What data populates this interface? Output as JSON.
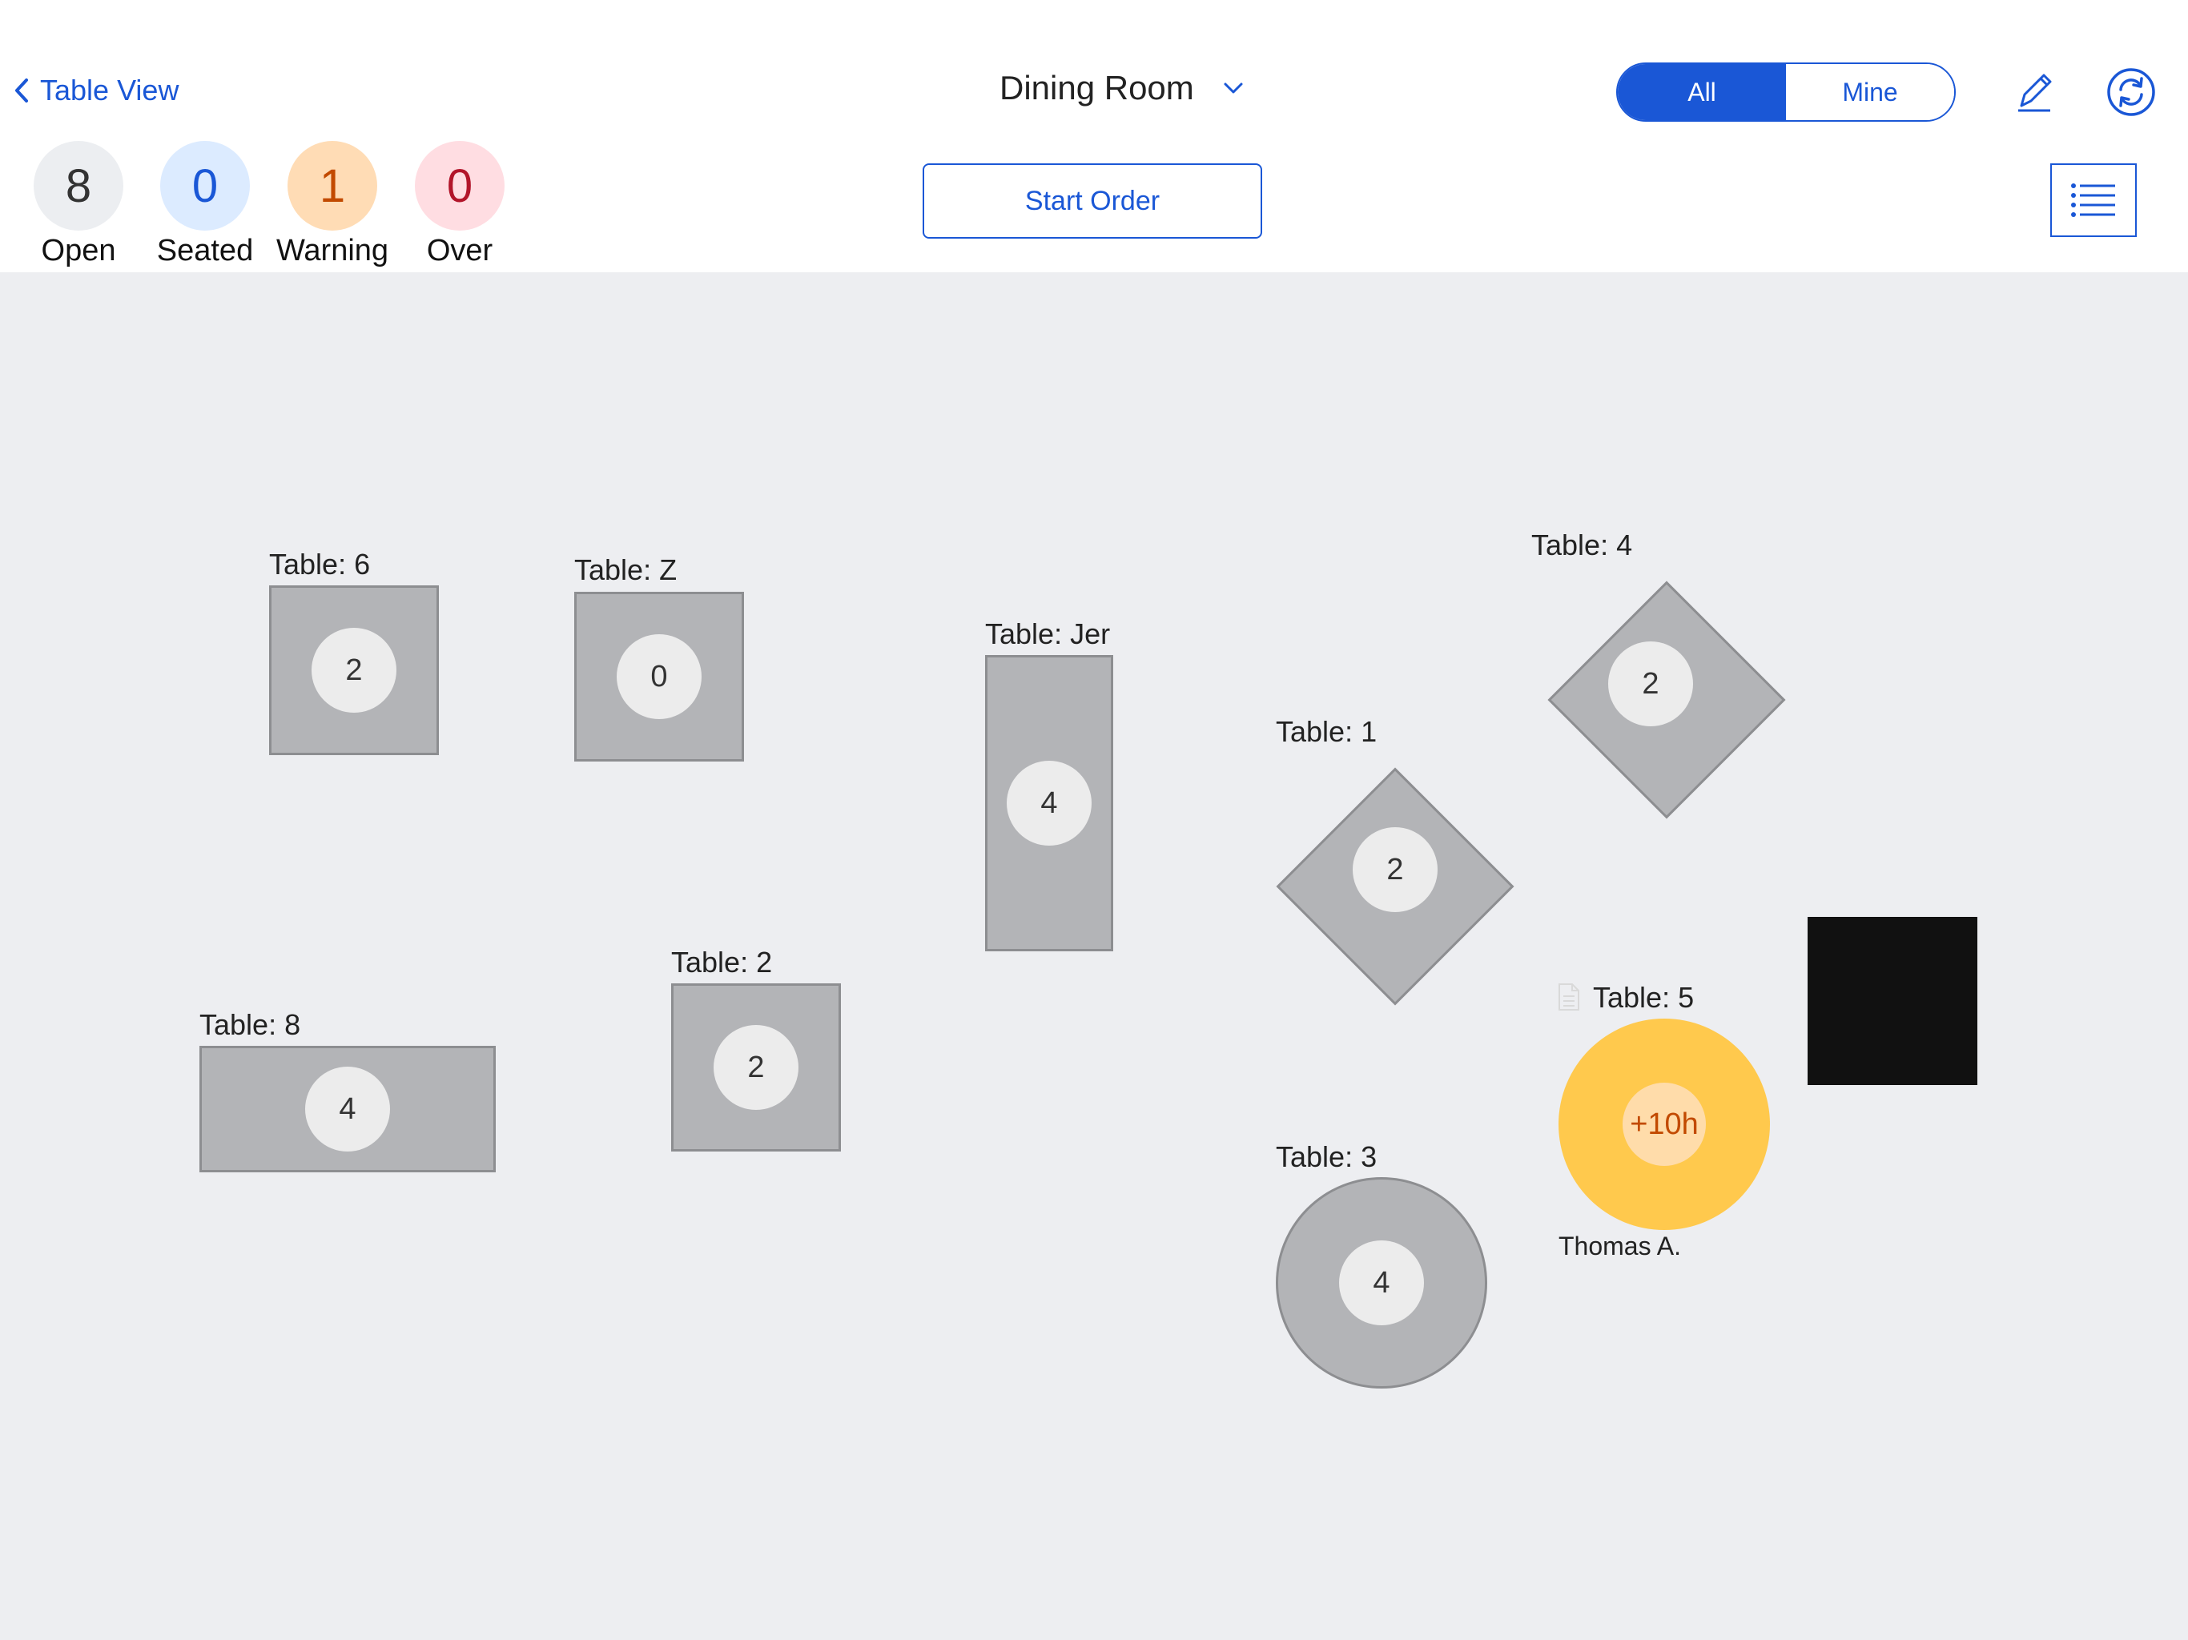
{
  "header": {
    "back_label": "Table View",
    "room_title": "Dining Room",
    "filter": {
      "all": "All",
      "mine": "Mine"
    },
    "start_order": "Start Order"
  },
  "stats": [
    {
      "count": "8",
      "label": "Open"
    },
    {
      "count": "0",
      "label": "Seated"
    },
    {
      "count": "1",
      "label": "Warning"
    },
    {
      "count": "0",
      "label": "Over"
    }
  ],
  "tables": {
    "t6": {
      "label": "Table: 6",
      "seats": "2"
    },
    "tz": {
      "label": "Table: Z",
      "seats": "0"
    },
    "tjer": {
      "label": "Table: Jer",
      "seats": "4"
    },
    "t4": {
      "label": "Table: 4",
      "seats": "2"
    },
    "t1": {
      "label": "Table: 1",
      "seats": "2"
    },
    "t8": {
      "label": "Table: 8",
      "seats": "4"
    },
    "t2": {
      "label": "Table: 2",
      "seats": "2"
    },
    "t5": {
      "label": "Table: 5",
      "time": "+10h",
      "server": "Thomas A."
    },
    "t3": {
      "label": "Table: 3",
      "seats": "4"
    }
  },
  "colors": {
    "accent": "#1a57d6",
    "open_bg": "#eceef1",
    "seated_bg": "#dcebff",
    "warning_bg": "#ffdcb5",
    "over_bg": "#ffdde2",
    "warning_table": "#ffc94d",
    "floor": "#edeef1"
  }
}
